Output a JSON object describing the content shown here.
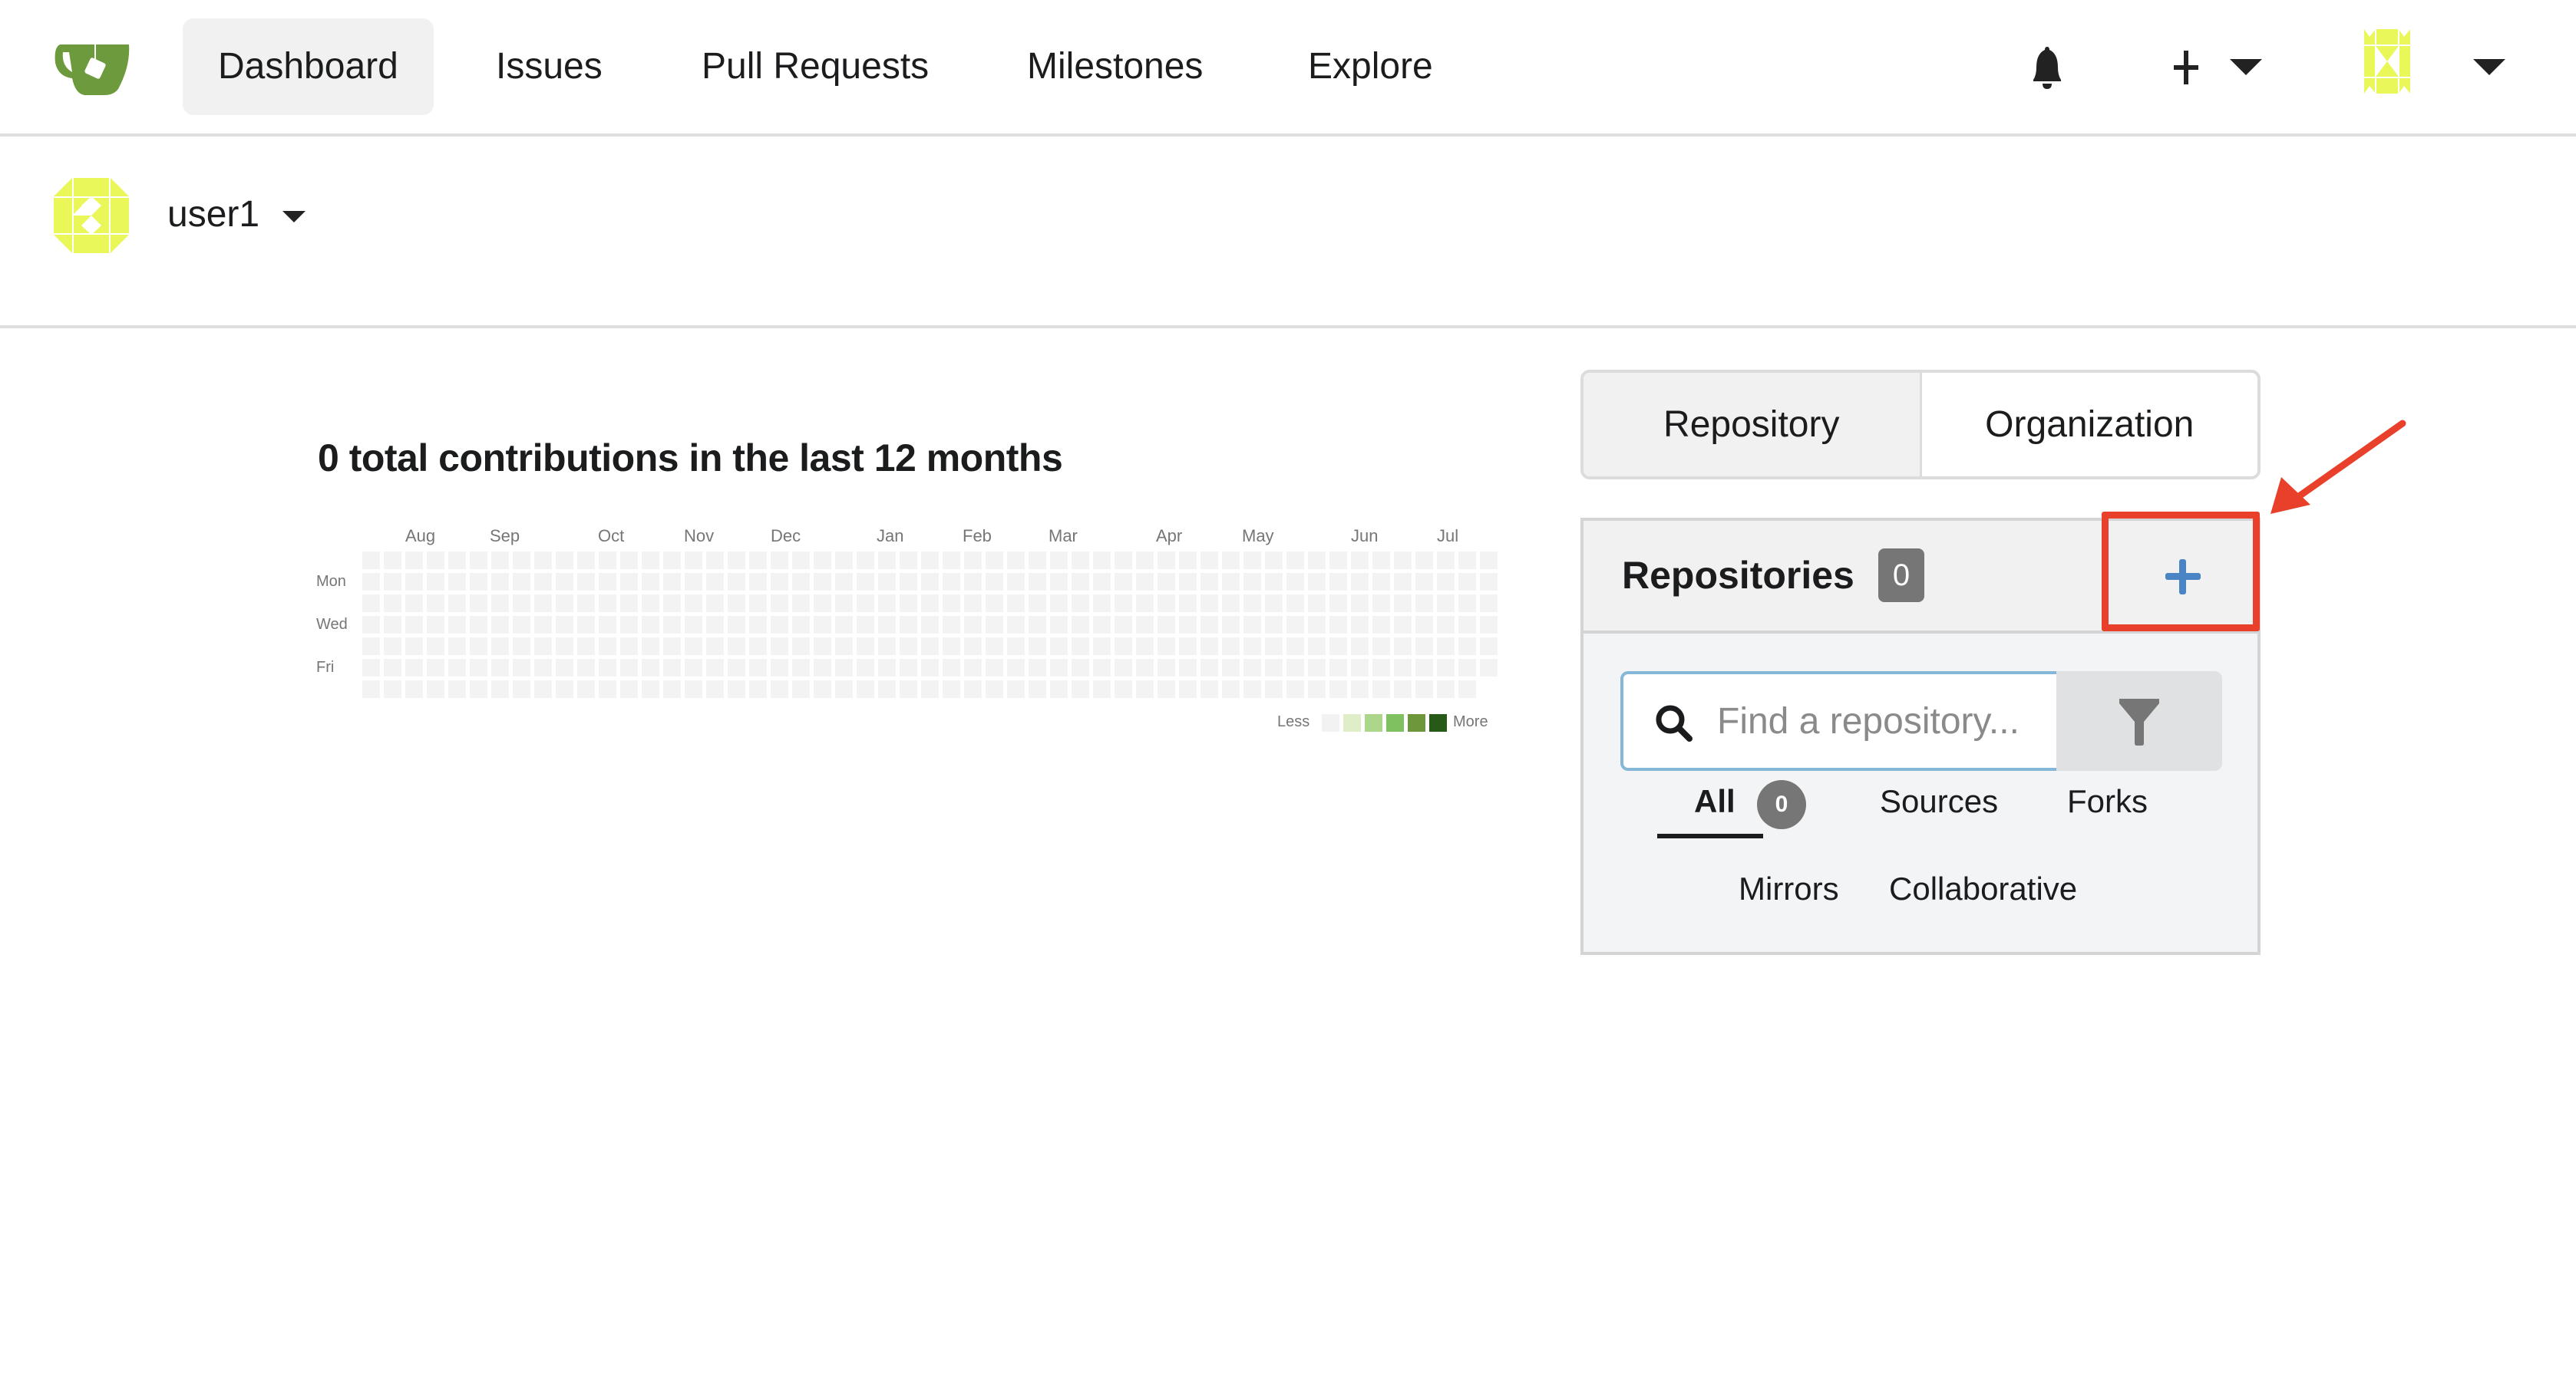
{
  "navbar": {
    "logo": "gitea-teacup-logo",
    "items": [
      {
        "label": "Dashboard",
        "active": true
      },
      {
        "label": "Issues",
        "active": false
      },
      {
        "label": "Pull Requests",
        "active": false
      },
      {
        "label": "Milestones",
        "active": false
      },
      {
        "label": "Explore",
        "active": false
      }
    ],
    "right_icons": [
      "bell-icon",
      "plus-icon",
      "caret-down-icon",
      "avatar",
      "caret-down-icon"
    ]
  },
  "context": {
    "username": "user1",
    "dropdown_icon": "caret-down-icon"
  },
  "heatmap": {
    "title": "0 total contributions in the last 12 months",
    "months": [
      "Aug",
      "Sep",
      "Oct",
      "Nov",
      "Dec",
      "Jan",
      "Feb",
      "Mar",
      "Apr",
      "May",
      "Jun",
      "Jul"
    ],
    "days": [
      "Mon",
      "Wed",
      "Fri"
    ],
    "legend_less": "Less",
    "legend_more": "More",
    "legend_colors": [
      "#f2f2f2",
      "#dfeec8",
      "#acd78a",
      "#7fc160",
      "#6e963a",
      "#285a17"
    ],
    "empty_color": "#f3f3f3",
    "weeks": 53,
    "last_week_days": 6,
    "total_contributions": 0
  },
  "switcher": {
    "tabs": [
      {
        "label": "Repository",
        "active": true
      },
      {
        "label": "Organization",
        "active": false
      }
    ]
  },
  "repos": {
    "title": "Repositories",
    "count": "0",
    "add_icon": "plus-icon",
    "search_placeholder": "Find a repository...",
    "search_value": "",
    "filter_icon": "filter-icon",
    "filters": [
      {
        "label": "All",
        "badge": "0",
        "active": true
      },
      {
        "label": "Sources",
        "active": false
      },
      {
        "label": "Forks",
        "active": false
      },
      {
        "label": "Mirrors",
        "active": false
      },
      {
        "label": "Collaborative",
        "active": false
      }
    ]
  },
  "annotation": {
    "color": "#e8402a",
    "target": "add-repository-button"
  }
}
